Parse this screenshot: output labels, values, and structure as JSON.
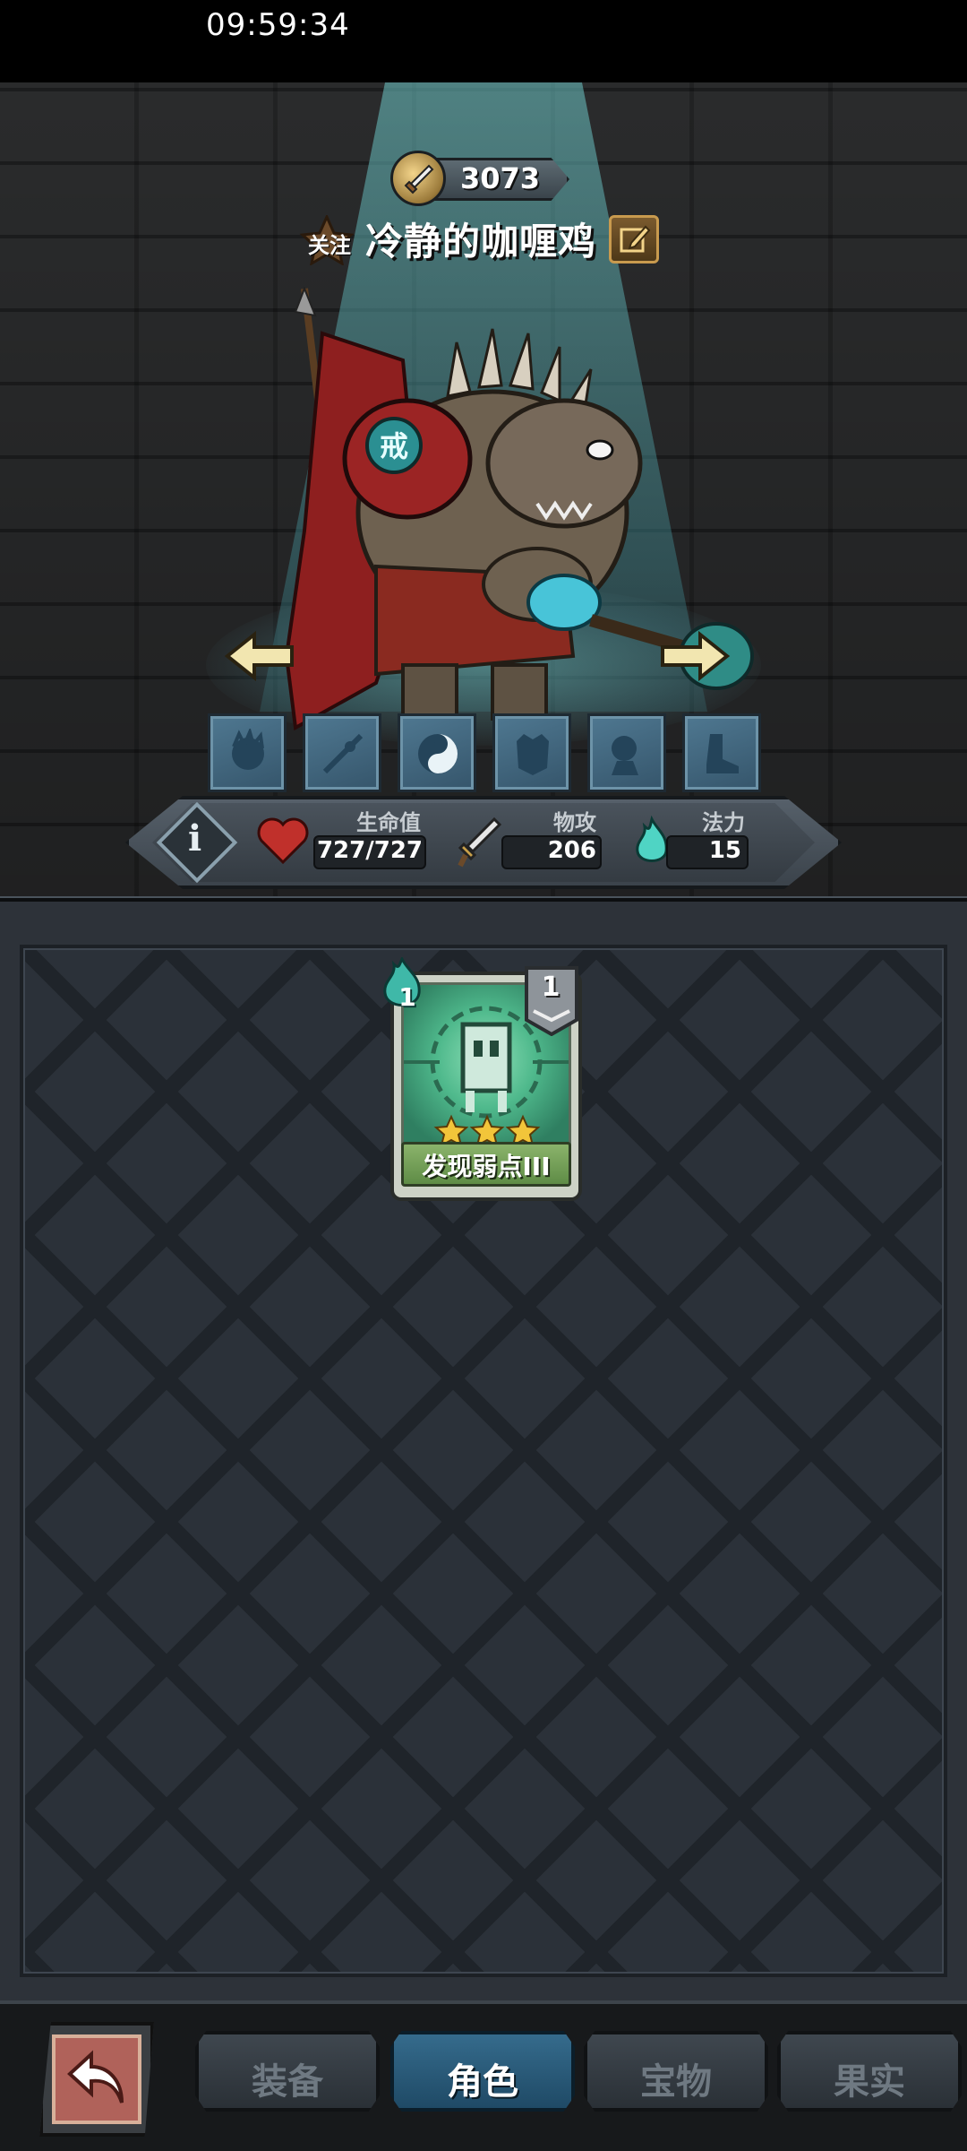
{
  "status_bar": {
    "time": "09:59:34"
  },
  "hero": {
    "power": "3073",
    "follow_label": "关注",
    "name": "冷静的咖喱鸡"
  },
  "stats": [
    {
      "key": "hp",
      "label": "生命值",
      "value": "727/727",
      "icon": "heart-icon"
    },
    {
      "key": "attack",
      "label": "物攻",
      "value": "206",
      "icon": "sword-icon"
    },
    {
      "key": "mana",
      "label": "法力",
      "value": "15",
      "icon": "spirit-flame-icon"
    }
  ],
  "equipment_slots": [
    {
      "icon": "head-slot-icon"
    },
    {
      "icon": "weapon-slot-icon"
    },
    {
      "icon": "yin-yang-slot-icon"
    },
    {
      "icon": "armor-slot-icon"
    },
    {
      "icon": "pet-slot-icon"
    },
    {
      "icon": "boots-slot-icon"
    }
  ],
  "cards": [
    {
      "name": "发现弱点III",
      "cost": "1",
      "level": "1",
      "stars": 3
    }
  ],
  "bottom_nav": {
    "back_icon": "back-arrow-icon",
    "tabs": [
      {
        "label": "装备",
        "active": false
      },
      {
        "label": "角色",
        "active": true
      },
      {
        "label": "宝物",
        "active": false
      },
      {
        "label": "果实",
        "active": false
      }
    ]
  },
  "colors": {
    "spotlight": "#6ec8c8",
    "active_tab": "#356b8c",
    "card_art": "#4fb98c"
  }
}
